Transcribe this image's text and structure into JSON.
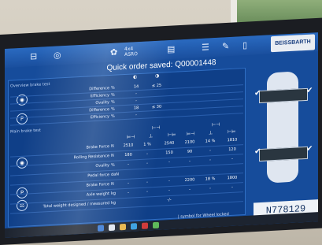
{
  "title": "Quick order saved: Q00001448",
  "logo": {
    "line1": "4x4",
    "line2": "ASRO"
  },
  "brand": "BEISSBARTH",
  "sections": {
    "service": "Overview brake test",
    "main": "Main brake test"
  },
  "service_rows": [
    {
      "label": "Difference",
      "unit": "%",
      "v1": "14",
      "v2": "≤ 25"
    },
    {
      "label": "Efficiency",
      "unit": "%",
      "v1": "-",
      "v2": ""
    },
    {
      "label": "Ovality",
      "unit": "%",
      "v1": "-",
      "v2": ""
    },
    {
      "label": "Difference",
      "unit": "%",
      "v1": "18",
      "v2": "≤ 30"
    },
    {
      "label": "Efficiency",
      "unit": "%",
      "v1": "-",
      "v2": ""
    }
  ],
  "main_rows": [
    {
      "label": "Brake Force",
      "unit": "N",
      "c": [
        "2510",
        "1 %",
        "2540",
        "2100",
        "14 %",
        "1810"
      ]
    },
    {
      "label": "Rolling Resistance",
      "unit": "N",
      "c": [
        "180",
        "-",
        "150",
        "90",
        "-",
        "120"
      ]
    },
    {
      "label": "Ovality",
      "unit": "%",
      "c": [
        "-",
        "-",
        "-",
        "-",
        "-",
        "-"
      ]
    },
    {
      "label": "Pedal force",
      "unit": "daN",
      "c": [
        "",
        "",
        "",
        "",
        "",
        ""
      ]
    },
    {
      "label": "Brake Force",
      "unit": "N",
      "c": [
        "-",
        "-",
        "-",
        "2200",
        "18 %",
        "1800"
      ]
    },
    {
      "label": "Axle weight",
      "unit": "kg",
      "c": [
        "-",
        "-",
        "-",
        "-",
        "-",
        "-"
      ]
    },
    {
      "label": "Total weight designed / measured",
      "unit": "kg",
      "c": [
        "",
        "",
        "-/-",
        "",
        "",
        ""
      ]
    }
  ],
  "footnote": "| symbol for Wheel locked",
  "vin": "N778129",
  "colors": {
    "screen_bg": "#164c9b",
    "panel": "#0f3f88",
    "accent": "#2f6ec4"
  }
}
